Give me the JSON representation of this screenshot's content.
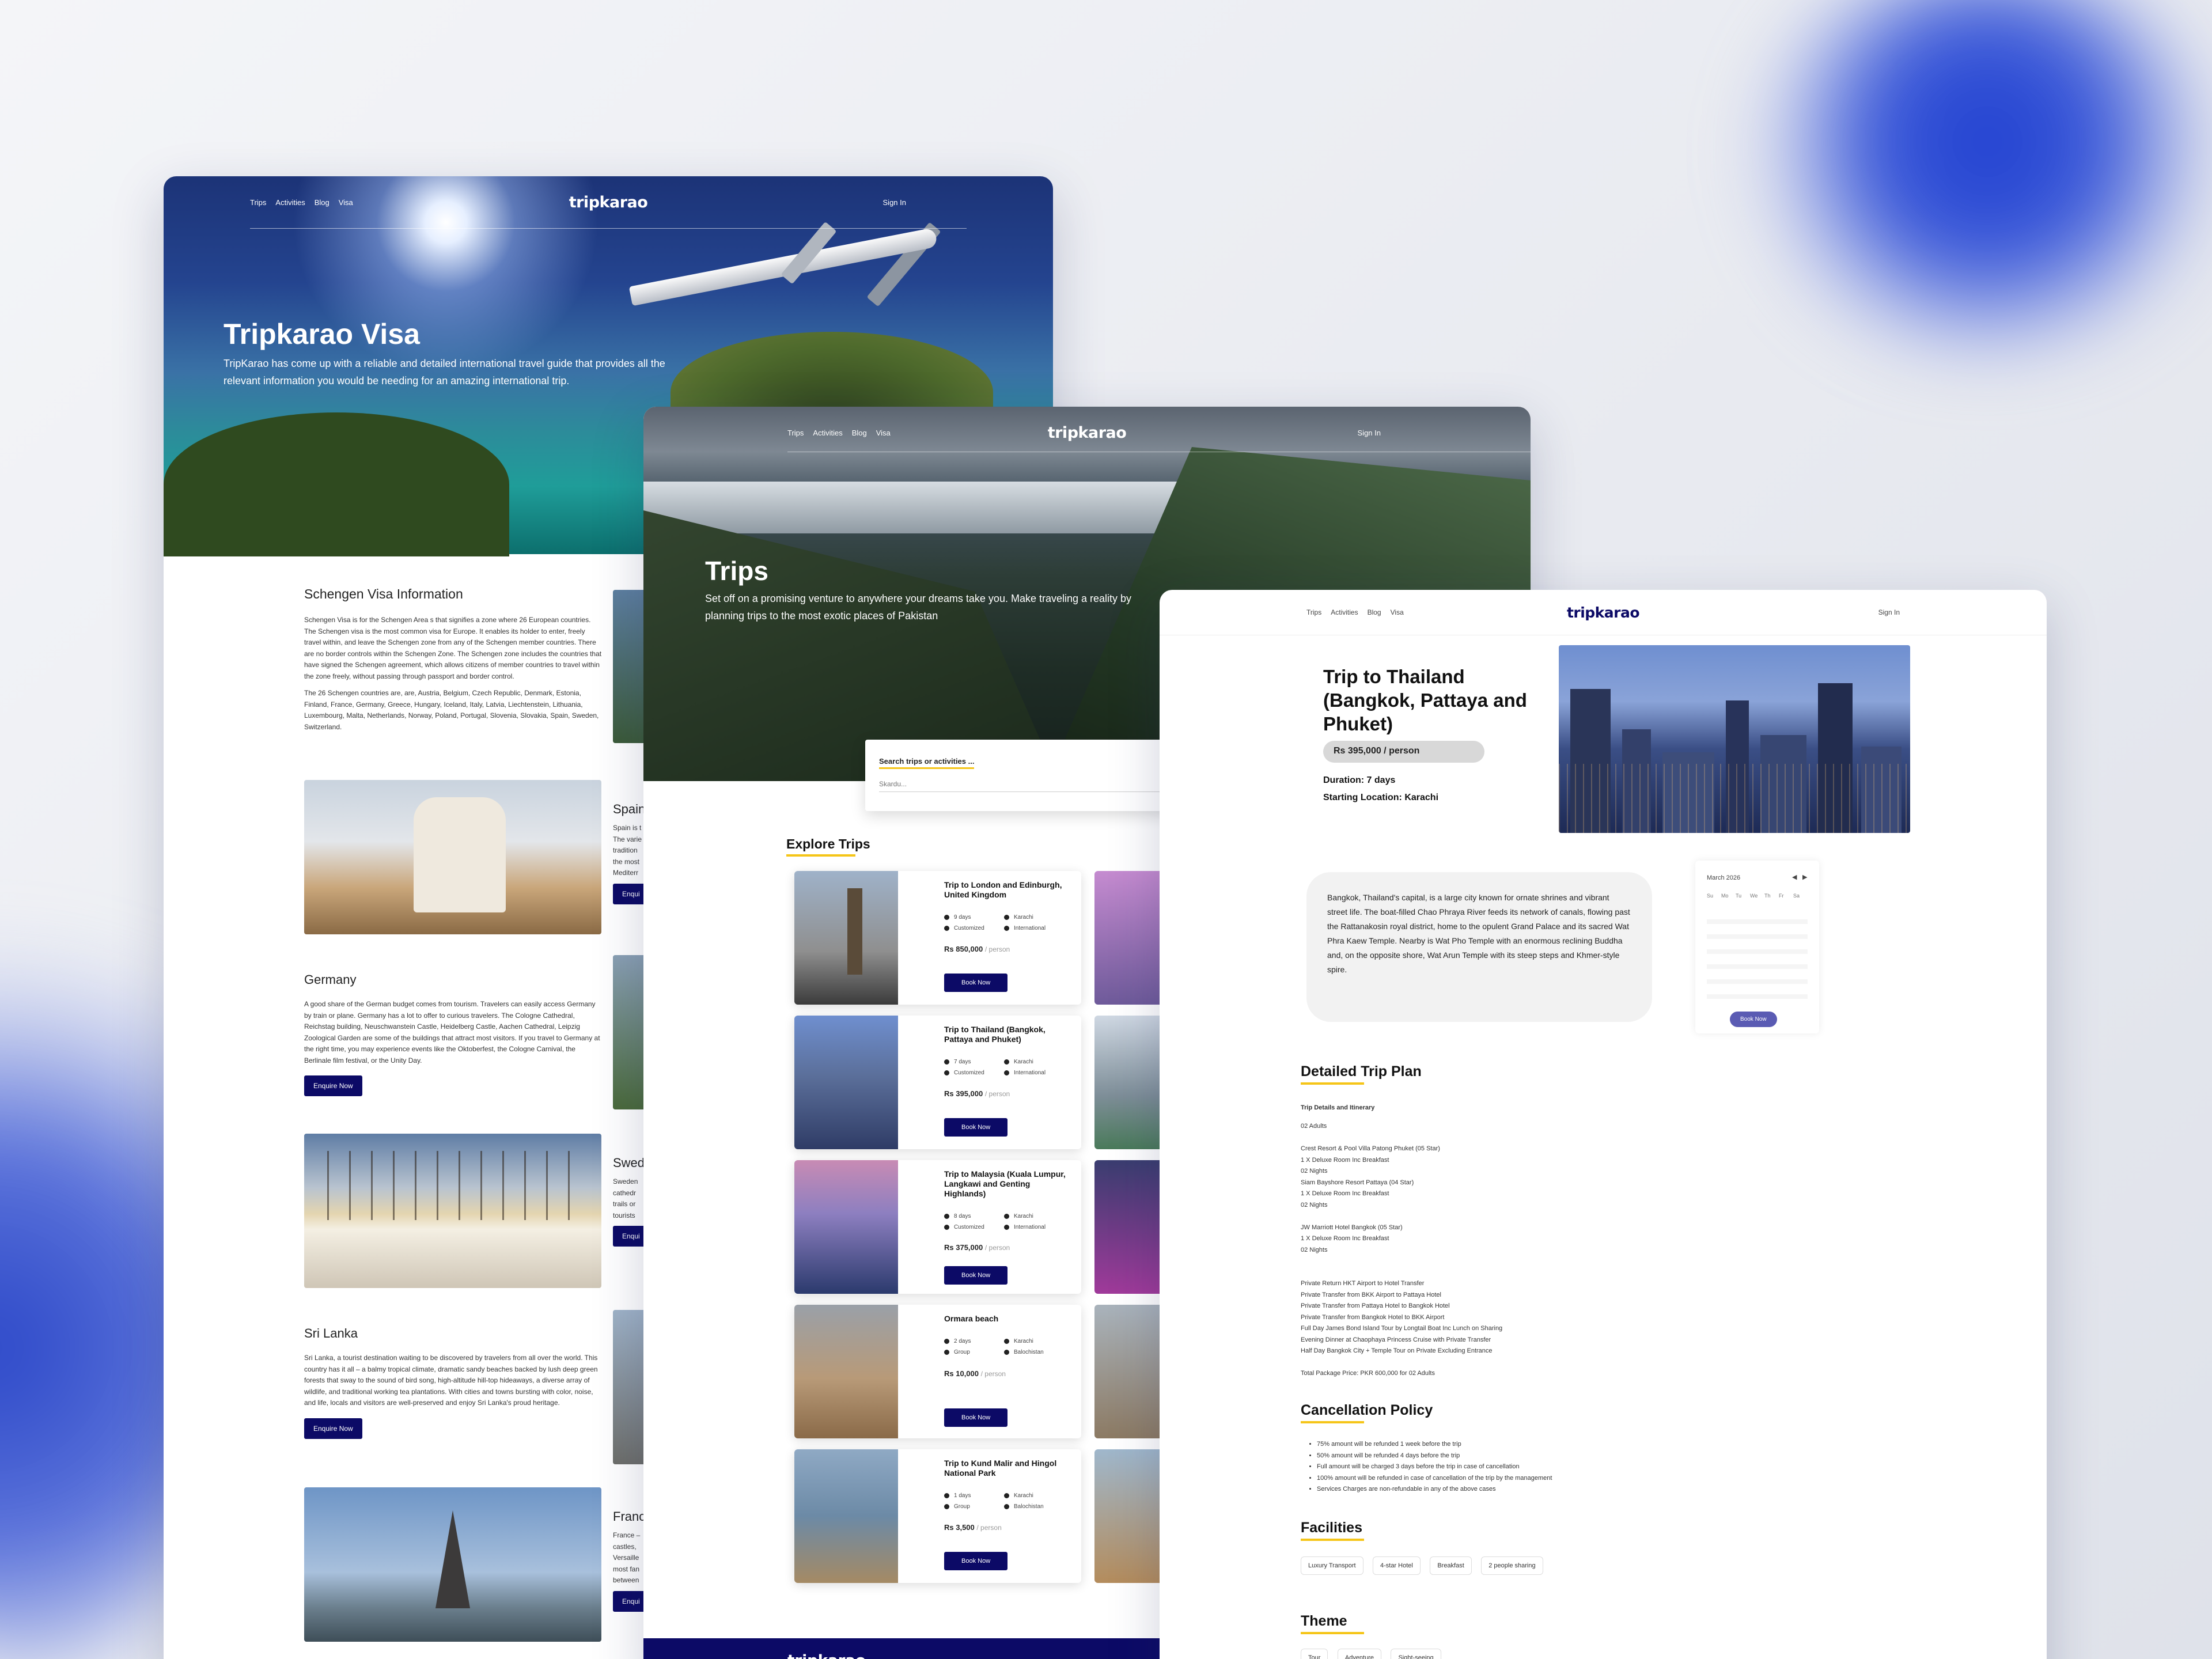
{
  "brand": {
    "logo": "tripkarao",
    "accent": "#0c0a66",
    "highlight": "#f5c518"
  },
  "nav": {
    "links": [
      "Trips",
      "Activities",
      "Blog",
      "Visa"
    ],
    "signin": "Sign In"
  },
  "visa_page": {
    "title": "Tripkarao Visa",
    "subtitle": "TripKarao has come up with a reliable and detailed international travel guide that provides all the relevant information you would be needing for an amazing international trip.",
    "schengen": {
      "heading": "Schengen Visa Information",
      "p1": "Schengen Visa is for the Schengen Area s that signifies a zone where 26 European countries. The Schengen visa is the most common visa for Europe. It enables its holder to enter, freely travel within, and leave the Schengen zone from any of the Schengen member countries. There are no border controls within the Schengen Zone. The Schengen zone includes the countries that have signed the Schengen agreement, which allows citizens of member countries to travel within the zone freely, without passing through passport and border control.",
      "p2": "The 26 Schengen countries are, are, Austria, Belgium, Czech Republic, Denmark, Estonia, Finland, France, Germany, Greece, Hungary, Iceland, Italy, Latvia, Liechtenstein, Lithuania, Luxembourg, Malta, Netherlands, Norway, Poland, Portugal, Slovenia, Slovakia, Spain, Sweden, Switzerland."
    },
    "right_col": [
      {
        "name": "Spain",
        "text": [
          "Spain is t",
          "The varie",
          "tradition",
          "the most",
          "Mediterr"
        ],
        "btn": "Enqui"
      },
      {
        "name": "Swed",
        "text": [
          "Sweden",
          "cathedr",
          "trails or",
          "tourists"
        ],
        "btn": "Enqui"
      },
      {
        "name": "Franc",
        "text": [
          "France –",
          "castles,",
          "Versaille",
          "most fan",
          "between"
        ],
        "btn": "Enqui"
      }
    ],
    "germany": {
      "name": "Germany",
      "text": "A good share of the German budget comes from tourism. Travelers can easily access Germany by train or plane. Germany has a lot to offer to curious travelers. The Cologne Cathedral, Reichstag building, Neuschwanstein Castle, Heidelberg Castle, Aachen Cathedral, Leipzig Zoological Garden are some of the buildings that attract most visitors. If you travel to Germany at the right time, you may experience events like the Oktoberfest, the Cologne Carnival, the Berlinale film festival, or the Unity Day.",
      "btn": "Enquire Now"
    },
    "srilanka": {
      "name": "Sri Lanka",
      "text": "Sri Lanka, a tourist destination waiting to be discovered by travelers from all over the world. This country has it all – a balmy tropical climate, dramatic sandy beaches backed by lush deep green forests that sway to the sound of bird song, high-altitude hill-top hideaways, a diverse array of wildlife, and traditional working tea plantations. With cities and towns bursting with color, noise, and life, locals and visitors are well-preserved and enjoy Sri Lanka's proud heritage.",
      "btn": "Enquire Now"
    }
  },
  "trips_page": {
    "title": "Trips",
    "subtitle": "Set off on a promising venture to anywhere your dreams take you. Make traveling a reality by planning trips to the most exotic places of Pakistan",
    "search": {
      "label": "Search trips or activities ...",
      "placeholder": "Skardu..."
    },
    "section": "Explore Trips",
    "cards": [
      {
        "title": "Trip to London and Edinburgh, United Kingdom",
        "days": "9 days",
        "type": "Customized",
        "from": "Karachi",
        "scope": "International",
        "price": "Rs 850,000",
        "per": "/ person",
        "btn": "Book Now"
      },
      {
        "title": "Trip to Thailand (Bangkok, Pattaya and Phuket)",
        "days": "7 days",
        "type": "Customized",
        "from": "Karachi",
        "scope": "International",
        "price": "Rs 395,000",
        "per": "/ person",
        "btn": "Book Now"
      },
      {
        "title": "Trip to Malaysia (Kuala Lumpur, Langkawi and Genting Highlands)",
        "days": "8 days",
        "type": "Customized",
        "from": "Karachi",
        "scope": "International",
        "price": "Rs 375,000",
        "per": "/ person",
        "btn": "Book Now"
      },
      {
        "title": "Ormara beach",
        "days": "2 days",
        "type": "Group",
        "from": "Karachi",
        "scope": "Balochistan",
        "price": "Rs 10,000",
        "per": "/ person",
        "btn": "Book Now"
      },
      {
        "title": "Trip to Kund Malir and Hingol National Park",
        "days": "1 days",
        "type": "Group",
        "from": "Karachi",
        "scope": "Balochistan",
        "price": "Rs 3,500",
        "per": "/ person",
        "btn": "Book Now"
      }
    ],
    "footer_logo": "tripkarao"
  },
  "detail_page": {
    "title": "Trip to Thailand (Bangkok, Pattaya and Phuket)",
    "price": "Rs 395,000 / person",
    "duration": "Duration: 7 days",
    "start": "Starting Location: Karachi",
    "description": "Bangkok, Thailand's capital, is a large city known for ornate shrines and vibrant street life. The boat-filled Chao Phraya River feeds its network of canals, flowing past the Rattanakosin royal district, home to the opulent Grand Palace and its sacred Wat Phra Kaew Temple. Nearby is Wat Pho Temple with an enormous reclining Buddha and, on the opposite shore, Wat Arun Temple with its steep steps and Khmer-style spire.",
    "calendar": {
      "month": "March 2026",
      "days": [
        "Su",
        "Mo",
        "Tu",
        "We",
        "Th",
        "Fr",
        "Sa"
      ],
      "btn": "Book Now"
    },
    "plan_heading": "Detailed Trip Plan",
    "plan_sub": "Trip Details and Itinerary",
    "plan_lines": [
      "02 Adults",
      "",
      "Crest Resort & Pool Villa Patong Phuket (05 Star)",
      "1 X Deluxe Room Inc Breakfast",
      "02 Nights",
      "Siam Bayshore Resort Pattaya (04 Star)",
      "1 X Deluxe Room Inc Breakfast",
      "02 Nights",
      "",
      "JW Marriott Hotel Bangkok (05 Star)",
      "1 X Deluxe Room Inc Breakfast",
      "02 Nights",
      "",
      "",
      "Private Return HKT Airport to Hotel Transfer",
      "Private Transfer from BKK Airport to Pattaya Hotel",
      "Private Transfer from Pattaya Hotel to Bangkok Hotel",
      "Private Transfer from Bangkok Hotel to BKK Airport",
      "Full Day James Bond Island Tour by Longtail Boat Inc Lunch on Sharing",
      "Evening Dinner at Chaophaya Princess Cruise with Private Transfer",
      "Half Day Bangkok City + Temple Tour on Private Excluding Entrance",
      "",
      "Total Package Price:  PKR 600,000 for 02 Adults"
    ],
    "cancel_heading": "Cancellation Policy",
    "cancel_items": [
      "75% amount will be refunded 1 week before the trip",
      "50% amount will be refunded 4 days before the trip",
      "Full amount will be charged 3 days before the trip in case of cancellation",
      "100% amount will be refunded in case of cancellation of the trip by the management",
      "Services Charges are non-refundable in any of the above cases"
    ],
    "facilities_heading": "Facilities",
    "facilities": [
      "Luxury Transport",
      "4-star Hotel",
      "Breakfast",
      "2 people sharing"
    ],
    "theme_heading": "Theme",
    "themes": [
      "Tour",
      "Adventure",
      "Sight-seeing"
    ]
  }
}
